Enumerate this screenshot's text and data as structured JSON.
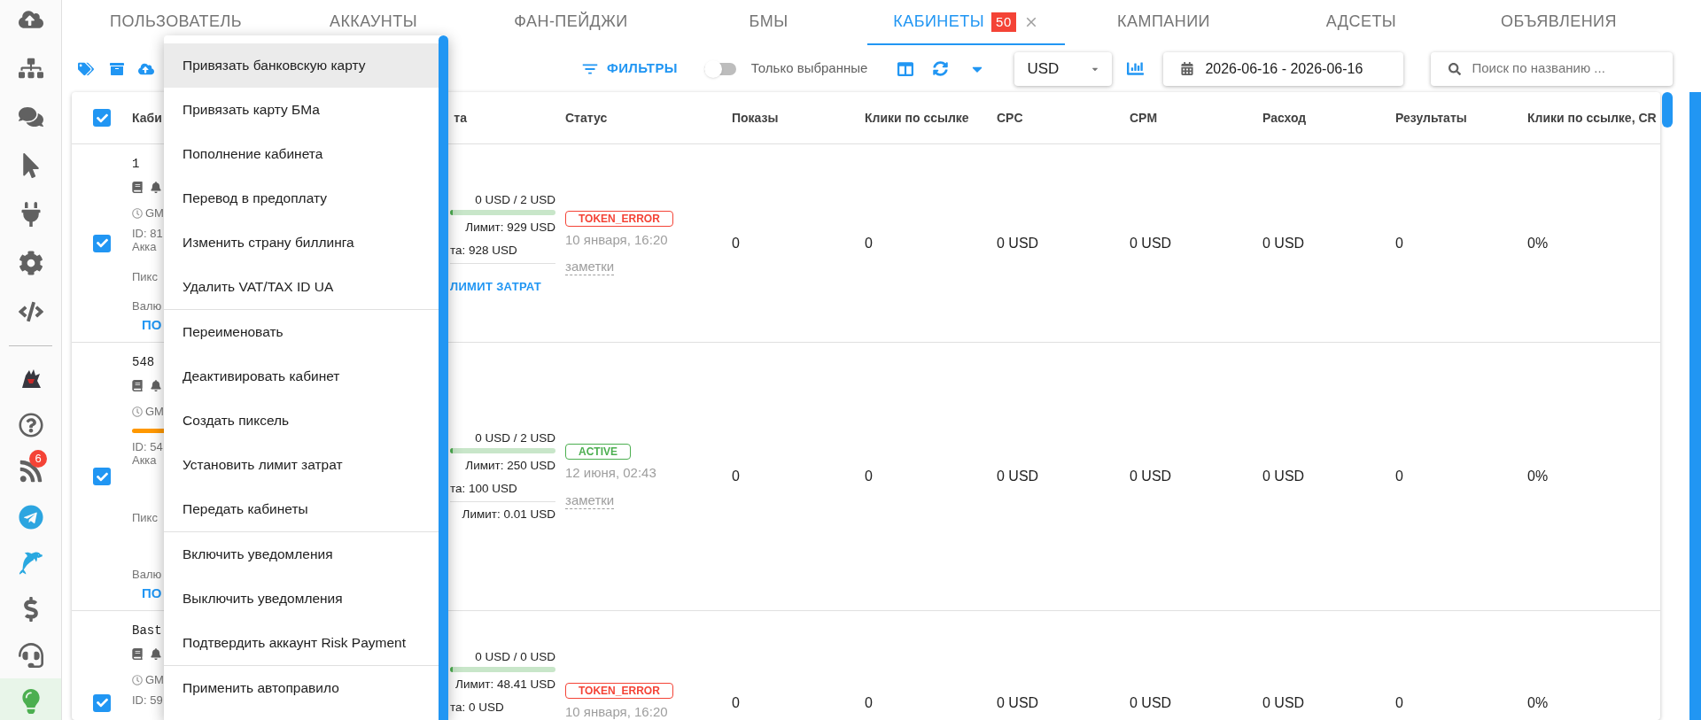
{
  "sidebar": {
    "items": [
      {
        "selected": false
      },
      {
        "selected": false
      },
      {
        "selected": false
      },
      {
        "selected": false
      },
      {
        "selected": false
      },
      {
        "selected": false
      },
      {
        "selected": false
      },
      {
        "selected": false
      },
      {
        "selected": false
      },
      {
        "selected": false,
        "badge": "6"
      },
      {
        "selected": false
      },
      {
        "selected": false
      },
      {
        "selected": false
      },
      {
        "selected": false
      },
      {
        "selected": true
      }
    ]
  },
  "tabs": [
    {
      "label": "ПОЛЬЗОВАТЕЛЬ",
      "selected": false,
      "closable": false
    },
    {
      "label": "АККАУНТЫ",
      "selected": false,
      "closable": false
    },
    {
      "label": "ФАН-ПЕЙДЖИ",
      "selected": false,
      "closable": false
    },
    {
      "label": "БМЫ",
      "selected": false,
      "closable": false
    },
    {
      "label": "КАБИНЕТЫ",
      "selected": true,
      "badge": "50",
      "closable": true
    },
    {
      "label": "КАМПАНИИ",
      "selected": false,
      "closable": false
    },
    {
      "label": "АДСЕТЫ",
      "selected": false,
      "closable": false
    },
    {
      "label": "ОБЪЯВЛЕНИЯ",
      "selected": false,
      "closable": false
    }
  ],
  "toolbar": {
    "filters": "ФИЛЬТРЫ",
    "only_selected": {
      "label": "Только выбранные",
      "on": false
    },
    "currency": "USD",
    "date_range": "2026-06-16 - 2026-06-16",
    "search": {
      "placeholder": "Поиск по названию ..."
    }
  },
  "table": {
    "select_all": {
      "checked": true
    },
    "columns": [
      "Каби",
      "та",
      "Статус",
      "Показы",
      "Клики по ссылке",
      "CPC",
      "CPM",
      "Расход",
      "Результаты",
      "Клики по ссылке, CR"
    ],
    "rows": [
      {
        "checked": true,
        "name": "1",
        "timezone": "GM",
        "warning_bar": false,
        "id": "ID: 81",
        "account": "Акка",
        "pixel": "Пикс",
        "currency": "Валю",
        "link": "ПО",
        "spent": "0 USD / 2 USD",
        "budget": {
          "level": 0
        },
        "limit": "Лимит: 929 USD",
        "balance": "та: 928 USD",
        "action": "ЛИМИТ ЗАТРАТ",
        "status": {
          "label": "TOKEN_ERROR",
          "color": "#f44336"
        },
        "date": "10 января, 16:20",
        "notes": "заметки",
        "values": [
          "0",
          "0",
          "0 USD",
          "0 USD",
          "0 USD",
          "0",
          "0%"
        ]
      },
      {
        "checked": true,
        "name": "548",
        "timezone": "GM",
        "warning_bar": true,
        "id": "ID: 54",
        "account": "Акка",
        "pixel": "Пикс",
        "currency": "Валю",
        "link": "ПО",
        "spent": "0 USD / 2 USD",
        "budget": {
          "level": 0
        },
        "limit": "Лимит: 250 USD",
        "balance": "та: 100 USD",
        "extra_limit": "Лимит: 0.01 USD",
        "status": {
          "label": "ACTIVE",
          "color": "#4caf50"
        },
        "date": "12 июня, 02:43",
        "notes": "заметки",
        "values": [
          "0",
          "0",
          "0 USD",
          "0 USD",
          "0 USD",
          "0",
          "0%"
        ]
      },
      {
        "checked": true,
        "name": "Bast",
        "timezone": "GM",
        "warning_bar": false,
        "id": "ID: 59",
        "spent": "0 USD / 0 USD",
        "budget": {
          "level": 0
        },
        "limit": "Лимит: 48.41 USD",
        "balance": "та: 0 USD",
        "status": {
          "label": "TOKEN_ERROR",
          "color": "#f44336"
        },
        "date": "10 января, 16:20",
        "values": [
          "0",
          "0",
          "0 USD",
          "0 USD",
          "0 USD",
          "0",
          "0%"
        ]
      }
    ]
  },
  "menu": {
    "groups": [
      {
        "items": [
          {
            "label": "Привязать банковскую карту",
            "highlighted": true
          },
          {
            "label": "Привязать карту БМа",
            "highlighted": false
          },
          {
            "label": "Пополнение кабинета",
            "highlighted": false
          },
          {
            "label": "Перевод в предоплату",
            "highlighted": false
          },
          {
            "label": "Изменить страну биллинга",
            "highlighted": false
          },
          {
            "label": "Удалить VAT/TAX ID UA",
            "highlighted": false
          }
        ]
      },
      {
        "items": [
          {
            "label": "Переименовать",
            "highlighted": false
          },
          {
            "label": "Деактивировать кабинет",
            "highlighted": false
          },
          {
            "label": "Создать пиксель",
            "highlighted": false
          },
          {
            "label": "Установить лимит затрат",
            "highlighted": false
          },
          {
            "label": "Передать кабинеты",
            "highlighted": false
          }
        ]
      },
      {
        "items": [
          {
            "label": "Включить уведомления",
            "highlighted": false
          },
          {
            "label": "Выключить уведомления",
            "highlighted": false
          },
          {
            "label": "Подтвердить аккаунт Risk Payment",
            "highlighted": false
          }
        ]
      },
      {
        "items": [
          {
            "label": "Применить автоправило",
            "highlighted": false
          }
        ]
      }
    ]
  }
}
